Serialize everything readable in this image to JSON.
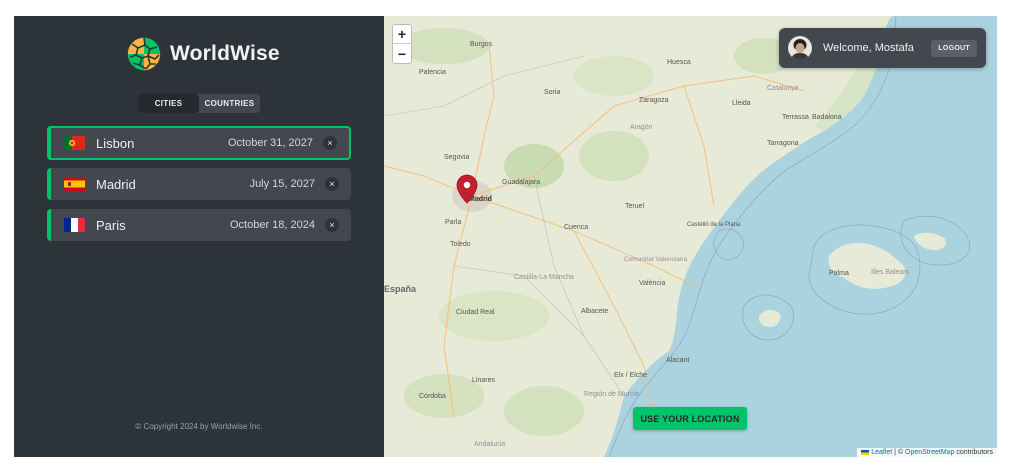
{
  "app": {
    "name": "WorldWise"
  },
  "tabs": [
    {
      "label": "CITIES",
      "active": true
    },
    {
      "label": "COUNTRIES",
      "active": false
    }
  ],
  "cities": [
    {
      "name": "Lisbon",
      "date": "October 31, 2027",
      "flag": "portugal",
      "active": true
    },
    {
      "name": "Madrid",
      "date": "July 15, 2027",
      "flag": "spain",
      "active": false
    },
    {
      "name": "Paris",
      "date": "October 18, 2024",
      "flag": "france",
      "active": false
    }
  ],
  "delete_glyph": "×",
  "footer": "© Copyright 2024 by Worldwise Inc.",
  "map": {
    "zoom_in": "+",
    "zoom_out": "−",
    "use_location": "USE YOUR LOCATION",
    "attribution": {
      "leaflet": "Leaflet",
      "separator": " | © ",
      "osm": "OpenStreetMap",
      "suffix": " contributors"
    },
    "labels": {
      "burgos": "Burgos",
      "huesca": "Huesca",
      "palencia": "Palencia",
      "soria": "Soria",
      "zaragoza": "Zaragoza",
      "lleida": "Lleida",
      "catalunya": "Catalunya",
      "aragon": "Aragón",
      "terrassa": "Terrassa",
      "badalona": "Badalona",
      "tarragona": "Tarragona",
      "segovia": "Segovia",
      "guadalajara": "Guadalajara",
      "madrid": "Madrid",
      "parla": "Parla",
      "toledo": "Toledo",
      "teruel": "Teruel",
      "cuenca": "Cuenca",
      "castello": "Castelló de la Plana",
      "comunitat": "Comunitat Valenciana",
      "valencia": "València",
      "palma": "Palma",
      "illes_balears": "Illes Balears",
      "espana": "España",
      "castilla": "Castilla-La Mancha",
      "ciudad_real": "Ciudad Real",
      "albacete": "Albacete",
      "alacant": "Alacant",
      "elx": "Elx / Elche",
      "linares": "Linares",
      "cordoba": "Córdoba",
      "andalucia": "Andalucía",
      "murcia": "Región de Murcia"
    }
  },
  "user": {
    "welcome": "Welcome, Mostafa",
    "logout": "LOGOUT"
  },
  "colors": {
    "accent": "#00c46a",
    "sidebar": "#2d3439",
    "panel": "#42484d",
    "sea": "#aad3df"
  }
}
